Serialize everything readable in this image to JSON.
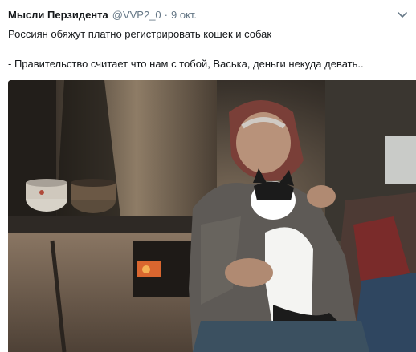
{
  "tweet": {
    "author_name": "Мысли Перзидента",
    "handle": "@VVP2_0",
    "separator": "·",
    "date": "9 окт.",
    "text_line_1": "Россиян обяжут платно регистрировать кошек и собак",
    "text_line_2": "- Правительство считает что нам с тобой, Васька, деньги некуда девать..",
    "menu_icon": "chevron-down-icon",
    "photo_description_icon": "photo"
  },
  "colors": {
    "text": "#14171a",
    "secondary": "#657786"
  }
}
